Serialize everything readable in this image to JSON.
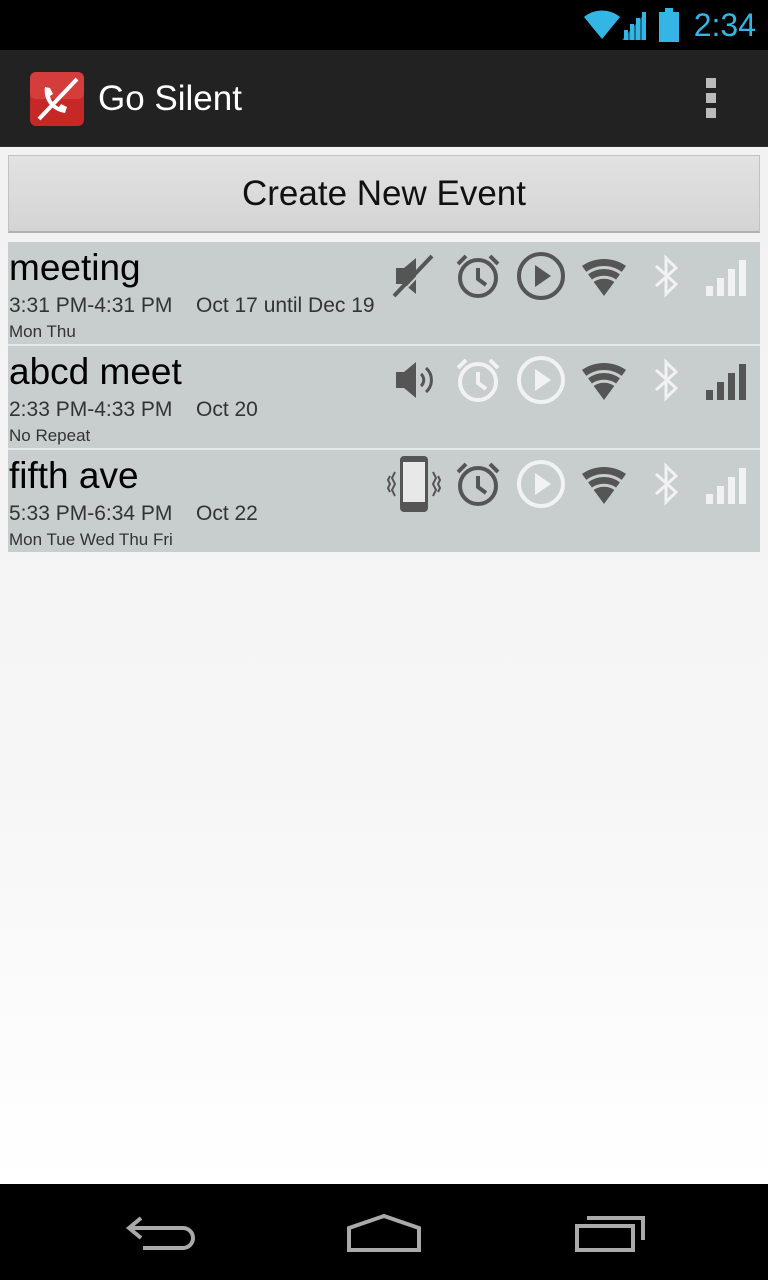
{
  "status_bar": {
    "time": "2:34",
    "icons": [
      "wifi-icon",
      "cell-signal-icon",
      "battery-icon"
    ],
    "accent_color": "#33b5e5"
  },
  "action_bar": {
    "title": "Go Silent",
    "app_icon": "go-silent-app-icon",
    "overflow_icon": "overflow-menu-icon"
  },
  "create_button": {
    "label": "Create New Event"
  },
  "events": [
    {
      "name": "meeting",
      "time_range": "3:31 PM-4:31 PM",
      "date_range": "Oct 17 until Dec 19",
      "repeat": "Mon Thu",
      "ringer_mode": "muted",
      "toggles": {
        "alarm": "disabled",
        "media": "disabled",
        "wifi": "disabled",
        "bluetooth": "disabled",
        "cellular": "disabled"
      }
    },
    {
      "name": "abcd meet",
      "time_range": "2:33 PM-4:33 PM",
      "date_range": "Oct 20",
      "repeat": "No Repeat",
      "ringer_mode": "sound-on",
      "toggles": {
        "alarm": "disabled",
        "media": "disabled",
        "wifi": "enabled",
        "bluetooth": "disabled",
        "cellular": "enabled"
      }
    },
    {
      "name": "fifth ave",
      "time_range": "5:33 PM-6:34 PM",
      "date_range": "Oct 22",
      "repeat": "Mon Tue Wed Thu Fri",
      "ringer_mode": "vibrate",
      "toggles": {
        "alarm": "enabled",
        "media": "disabled",
        "wifi": "enabled",
        "bluetooth": "disabled",
        "cellular": "disabled"
      }
    }
  ],
  "nav_bar": {
    "buttons": [
      "back-icon",
      "home-icon",
      "recent-apps-icon"
    ]
  },
  "colors": {
    "row_background": "#c8cecd",
    "icon_enabled": "#555555",
    "icon_disabled": "#f2f2f2"
  }
}
